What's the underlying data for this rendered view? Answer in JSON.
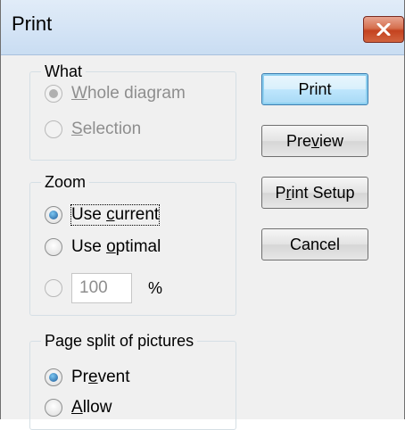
{
  "window": {
    "title": "Print"
  },
  "what": {
    "legend": "What",
    "options": [
      {
        "label": "Whole diagram",
        "mnemonic": "W",
        "rest": "hole diagram",
        "checked": true,
        "disabled": true
      },
      {
        "label": "Selection",
        "mnemonic": "S",
        "rest": "election",
        "checked": false,
        "disabled": true
      }
    ]
  },
  "zoom": {
    "legend": "Zoom",
    "use_current": {
      "pre": "Use ",
      "mnemonic": "c",
      "rest": "urrent",
      "checked": true
    },
    "use_optimal": {
      "pre": "Use ",
      "mnemonic": "o",
      "rest": "ptimal",
      "checked": false
    },
    "custom": {
      "value": "100",
      "unit": "%",
      "checked": false
    }
  },
  "page_split": {
    "legend": "Page split of pictures",
    "prevent": {
      "pre": "Pr",
      "mnemonic": "e",
      "rest": "vent",
      "checked": true
    },
    "allow": {
      "pre": "",
      "mnemonic": "A",
      "rest": "llow",
      "checked": false
    }
  },
  "buttons": {
    "print": "Print",
    "preview": {
      "pre": "Pre",
      "mnemonic": "v",
      "rest": "iew"
    },
    "print_setup": {
      "pre": "P",
      "mnemonic": "r",
      "rest": "int Setup"
    },
    "cancel": "Cancel"
  },
  "icons": {
    "close": "close-icon"
  },
  "colors": {
    "close_button": "#c4421f",
    "default_button_border": "#3c7fb1"
  }
}
